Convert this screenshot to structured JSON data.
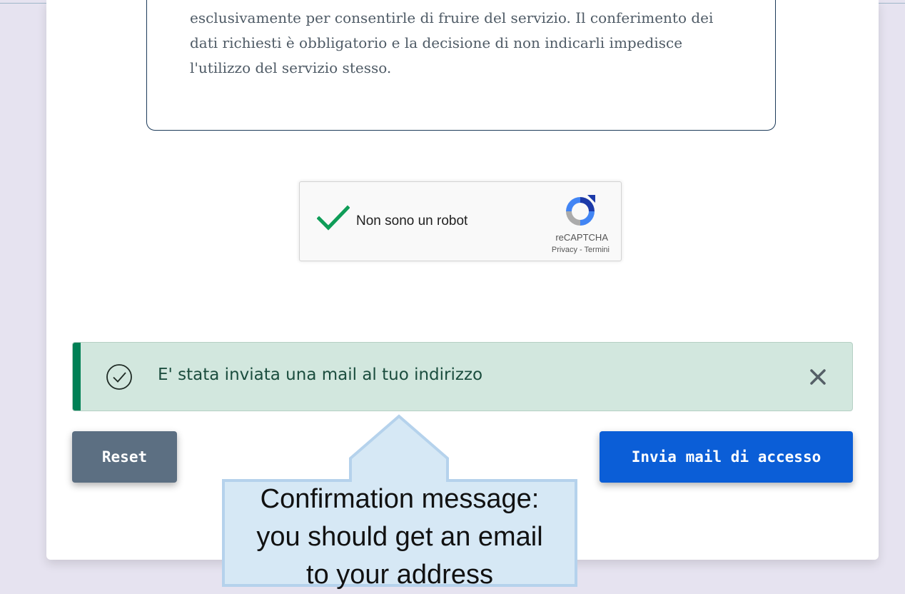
{
  "privacy": {
    "lines": [
      "esclusivamente per consentirle di fruire del servizio. Il conferimento dei",
      "dati richiesti è obbligatorio e la decisione di non indicarli impedisce",
      "l'utilizzo del servizio stesso."
    ]
  },
  "recaptcha": {
    "label": "Non sono un robot",
    "brand": "reCAPTCHA",
    "privacy_link": "Privacy",
    "separator": " - ",
    "terms_link": "Termini",
    "checked": true
  },
  "alert": {
    "message": "E' stata inviata una mail al tuo indirizzo",
    "icon": "check-circle-icon",
    "close_icon": "close-icon",
    "colors": {
      "background": "#d2e7de",
      "accent": "#008055",
      "text": "#1b4d3e"
    }
  },
  "buttons": {
    "reset_label": "Reset",
    "send_label": "Invia mail di accesso"
  },
  "callout": {
    "lines": [
      "Confirmation message:",
      "you should get an email",
      "to your address"
    ]
  },
  "colors": {
    "reset_button": "#5c6f82",
    "send_button": "#0b5ed7",
    "page_background": "#e6e3f0"
  }
}
